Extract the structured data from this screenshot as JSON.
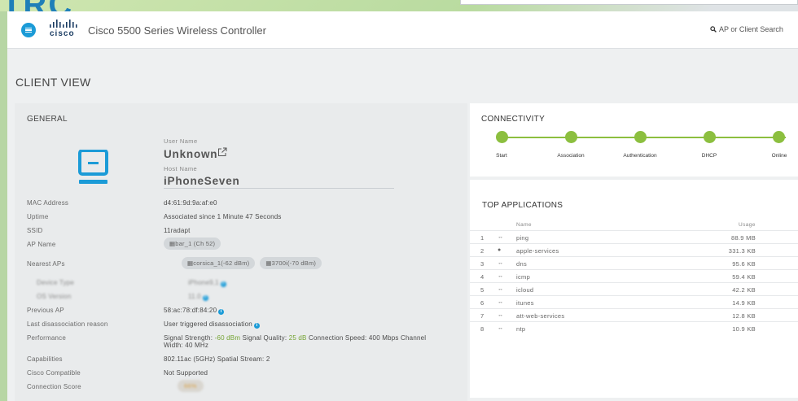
{
  "background": {
    "partial_text": "TRC"
  },
  "header": {
    "logo_text": "cisco",
    "title": "Cisco 5500 Series Wireless Controller",
    "search_placeholder": "AP or Client Search"
  },
  "page_title": "CLIENT VIEW",
  "general": {
    "title": "GENERAL",
    "user_name_label": "User Name",
    "user_name": "Unknown",
    "host_name_label": "Host Name",
    "host_name": "iPhoneSeven",
    "rows": {
      "mac_label": "MAC Address",
      "mac": "d4:61:9d:9a:af:e0",
      "uptime_label": "Uptime",
      "uptime": "Associated since 1 Minute 47 Seconds",
      "ssid_label": "SSID",
      "ssid": "11radapt",
      "ap_name_label": "AP Name",
      "ap_name": "bar_1 (Ch 52)",
      "nearest_label": "Nearest APs",
      "nearest_1": "corsica_1(-62 dBm)",
      "nearest_2": "3700i(-70 dBm)",
      "device_type_label": "Device Type",
      "device_type": "iPhone9,1",
      "os_label": "OS Version",
      "os": "11.0",
      "prev_ap_label": "Previous AP",
      "prev_ap": "58:ac:78:df:84:20",
      "last_dis_label": "Last disassociation reason",
      "last_dis": "User triggered disassociation",
      "perf_label": "Performance",
      "perf_ss_label": "Signal Strength:",
      "perf_ss": "-60 dBm",
      "perf_sq_label": "Signal Quality:",
      "perf_sq": "25 dB",
      "perf_cs": "Connection Speed: 400 Mbps Channel",
      "perf_width": "Width: 40 MHz",
      "cap_label": "Capabilities",
      "cap": "802.11ac (5GHz) Spatial Stream: 2",
      "cc_label": "Cisco Compatible",
      "cc": "Not Supported",
      "score_label": "Connection Score",
      "score": "66%"
    }
  },
  "connectivity": {
    "title": "CONNECTIVITY",
    "steps": [
      "Start",
      "Association",
      "Authentication",
      "DHCP",
      "Online"
    ],
    "color": "#8cbf3f"
  },
  "top_apps": {
    "title": "TOP APPLICATIONS",
    "col_name": "Name",
    "col_usage": "Usage",
    "rows": [
      {
        "num": "1",
        "icon": "↔",
        "name": "ping",
        "usage": "88.9 MB"
      },
      {
        "num": "2",
        "icon": "",
        "name": "apple-services",
        "usage": "331.3 KB"
      },
      {
        "num": "3",
        "icon": "↔",
        "name": "dns",
        "usage": "95.6 KB"
      },
      {
        "num": "4",
        "icon": "↔",
        "name": "icmp",
        "usage": "59.4 KB"
      },
      {
        "num": "5",
        "icon": "↔",
        "name": "icloud",
        "usage": "42.2 KB"
      },
      {
        "num": "6",
        "icon": "↔",
        "name": "itunes",
        "usage": "14.9 KB"
      },
      {
        "num": "7",
        "icon": "↔",
        "name": "att-web-services",
        "usage": "12.8 KB"
      },
      {
        "num": "8",
        "icon": "↔",
        "name": "ntp",
        "usage": "10.9 KB"
      }
    ]
  }
}
